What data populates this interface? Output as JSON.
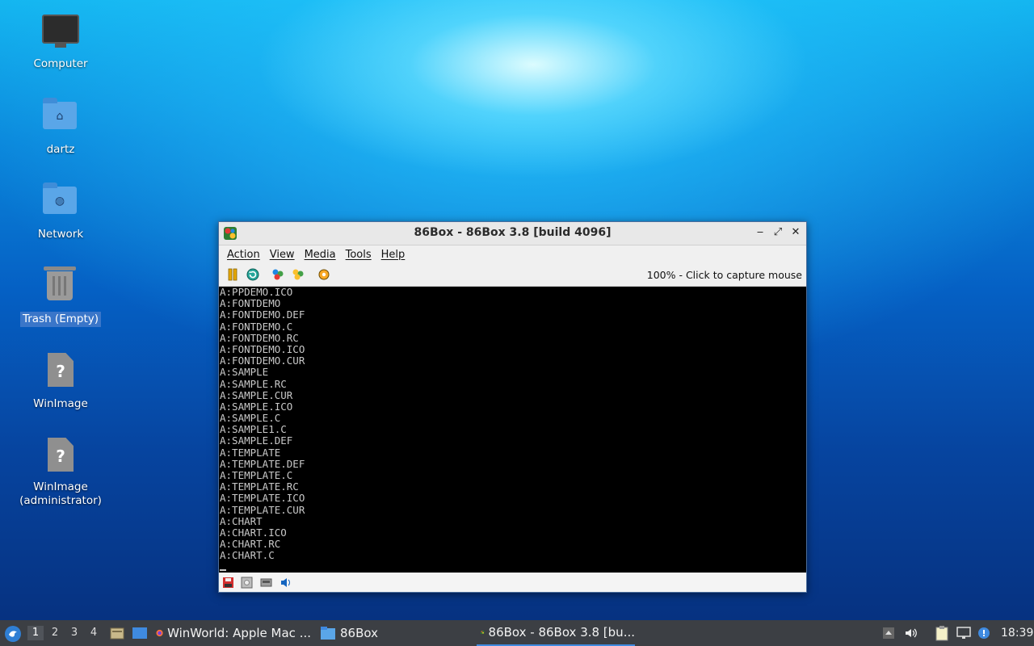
{
  "desktop": {
    "icons": [
      {
        "label": "Computer"
      },
      {
        "label": "dartz"
      },
      {
        "label": "Network"
      },
      {
        "label": "Trash (Empty)"
      },
      {
        "label": "WinImage"
      },
      {
        "label": "WinImage (administrator)",
        "line1": "WinImage",
        "line2": "(administrator)"
      }
    ]
  },
  "window": {
    "title": "86Box - 86Box 3.8 [build 4096]",
    "menu": [
      "Action",
      "View",
      "Media",
      "Tools",
      "Help"
    ],
    "toolbar": {
      "status": "100% - Click to capture mouse",
      "buttons": [
        "pause-icon",
        "reset-icon",
        "ctrl-alt-del-icon",
        "ctrl-alt-esc-icon",
        "settings-icon"
      ]
    },
    "screen_lines": [
      "A:PPDEMO.ICO",
      "A:FONTDEMO",
      "A:FONTDEMO.DEF",
      "A:FONTDEMO.C",
      "A:FONTDEMO.RC",
      "A:FONTDEMO.ICO",
      "A:FONTDEMO.CUR",
      "A:SAMPLE",
      "A:SAMPLE.RC",
      "A:SAMPLE.CUR",
      "A:SAMPLE.ICO",
      "A:SAMPLE.C",
      "A:SAMPLE1.C",
      "A:SAMPLE.DEF",
      "A:TEMPLATE",
      "A:TEMPLATE.DEF",
      "A:TEMPLATE.C",
      "A:TEMPLATE.RC",
      "A:TEMPLATE.ICO",
      "A:TEMPLATE.CUR",
      "A:CHART",
      "A:CHART.ICO",
      "A:CHART.RC",
      "A:CHART.C"
    ]
  },
  "taskbar": {
    "workspaces": [
      "1",
      "2",
      "3",
      "4"
    ],
    "tasks": [
      {
        "label": "WinWorld: Apple Mac ..."
      },
      {
        "label": "86Box"
      },
      {
        "label": "86Box - 86Box 3.8 [bu..."
      }
    ],
    "clock": "18:39"
  },
  "colors": {
    "accent": "#3f8ae0",
    "selection": "#3a76c9",
    "taskbar": "#3c3f44"
  }
}
